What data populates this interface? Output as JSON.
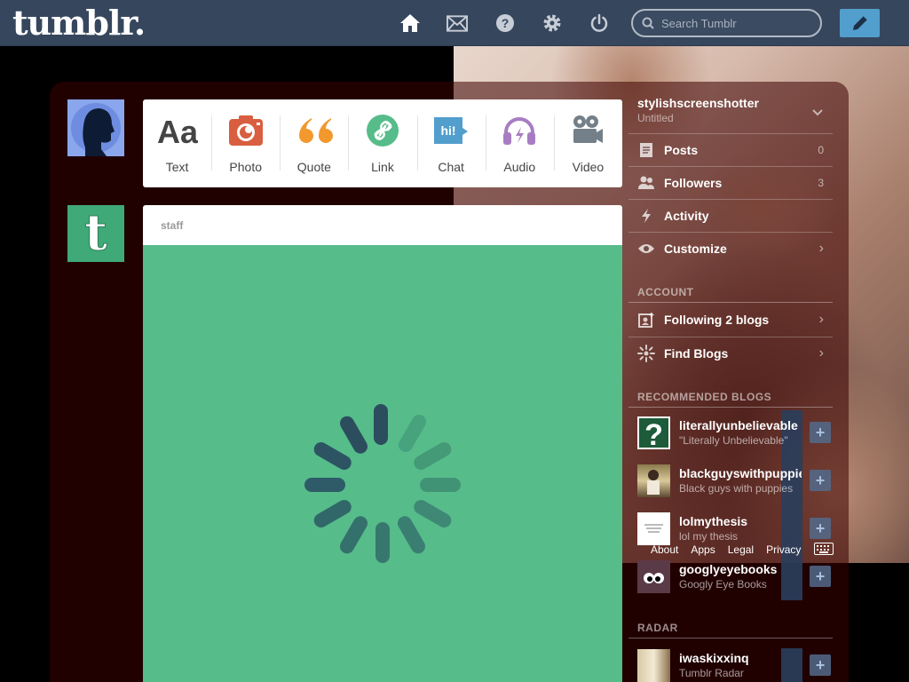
{
  "header": {
    "logo": "tumblr.",
    "search_placeholder": "Search Tumblr",
    "nav": [
      "home-icon",
      "mail-icon",
      "help-icon",
      "settings-icon",
      "power-icon"
    ]
  },
  "post_types": [
    {
      "label": "Text",
      "icon": "text-icon",
      "color": "#444444"
    },
    {
      "label": "Photo",
      "icon": "camera-icon",
      "color": "#d95e40"
    },
    {
      "label": "Quote",
      "icon": "quote-icon",
      "color": "#f2992e"
    },
    {
      "label": "Link",
      "icon": "link-icon",
      "color": "#56bc8a"
    },
    {
      "label": "Chat",
      "icon": "chat-icon",
      "color": "#529ecc"
    },
    {
      "label": "Audio",
      "icon": "audio-icon",
      "color": "#a77dc2"
    },
    {
      "label": "Video",
      "icon": "video-icon",
      "color": "#748089"
    }
  ],
  "post": {
    "author": "staff",
    "background": "#56bc8a",
    "loading": true
  },
  "sidebar": {
    "blog_name": "stylishscreenshotter",
    "blog_subtitle": "Untitled",
    "items": [
      {
        "label": "Posts",
        "count": "0"
      },
      {
        "label": "Followers",
        "count": "3"
      },
      {
        "label": "Activity",
        "count": ""
      },
      {
        "label": "Customize",
        "count": ""
      }
    ],
    "account_heading": "ACCOUNT",
    "account_items": [
      {
        "label": "Following 2 blogs"
      },
      {
        "label": "Find Blogs"
      }
    ],
    "recommended_heading": "RECOMMENDED BLOGS",
    "recommended": [
      {
        "name": "literallyunbelievable",
        "desc": "\"Literally Unbelievable\""
      },
      {
        "name": "blackguyswithpuppies",
        "desc": "Black guys with puppies"
      },
      {
        "name": "lolmythesis",
        "desc": "lol my thesis"
      },
      {
        "name": "googlyeyebooks",
        "desc": "Googly Eye Books"
      }
    ],
    "radar_heading": "RADAR",
    "radar": {
      "name": "iwaskixxinq",
      "desc": "Tumblr Radar"
    }
  },
  "footer_links": [
    "About",
    "Apps",
    "Legal",
    "Privacy"
  ]
}
